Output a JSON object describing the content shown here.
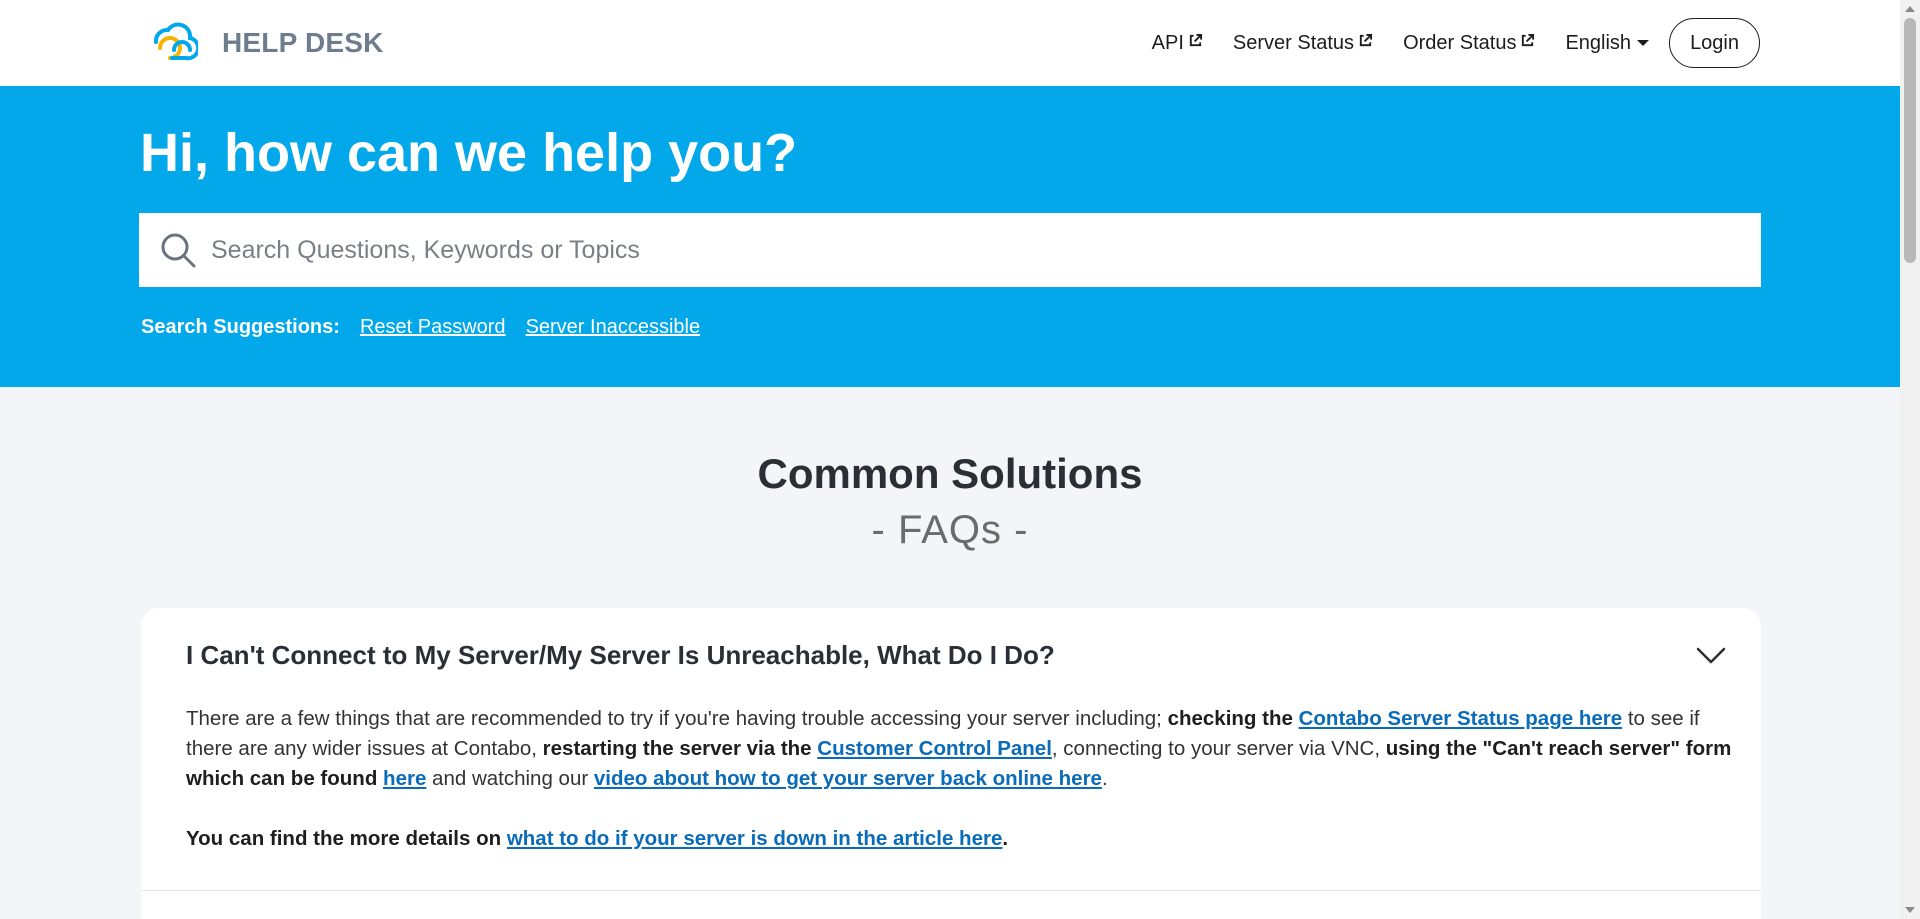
{
  "header": {
    "brand_name": "HELP DESK",
    "logo_icon": "cloud-logo-icon",
    "nav": [
      {
        "label": "API",
        "external": true
      },
      {
        "label": "Server Status",
        "external": true
      },
      {
        "label": "Order Status",
        "external": true
      }
    ],
    "language": "English",
    "login_label": "Login"
  },
  "hero": {
    "title": "Hi, how can we help you?",
    "search_placeholder": "Search Questions, Keywords or Topics",
    "suggestions_label": "Search Suggestions:",
    "suggestions": [
      "Reset Password",
      "Server Inaccessible"
    ]
  },
  "main": {
    "section_title": "Common Solutions",
    "section_subtitle": "- FAQs -",
    "faq": {
      "question": "I Can't Connect to My Server/My Server Is Unreachable, What Do I Do?",
      "p1": {
        "t1": "There are a few things that are recommended to try if you're having trouble accessing your server including; ",
        "b1": "checking the ",
        "l1": "Contabo Server Status page here",
        "t2": " to see if there are any wider issues at Contabo, ",
        "b2": "restarting the server via the ",
        "l2": "Customer Control Panel",
        "t3": ", connecting to your server via VNC, ",
        "b3": "using the \"Can't reach server\" form which can be found ",
        "l3": "here",
        "t4": " and watching our ",
        "l4": "video about how to get your server back online here",
        "t5": "."
      },
      "p2": {
        "b1": "You can find the more details on ",
        "l1": "what to do if your server is down in the article here",
        "b2": "."
      }
    }
  },
  "colors": {
    "hero_bg": "#02a8e9",
    "link": "#0a6bb8",
    "page_bg": "#f4f5f8",
    "brand_text": "#6e7d8e"
  }
}
